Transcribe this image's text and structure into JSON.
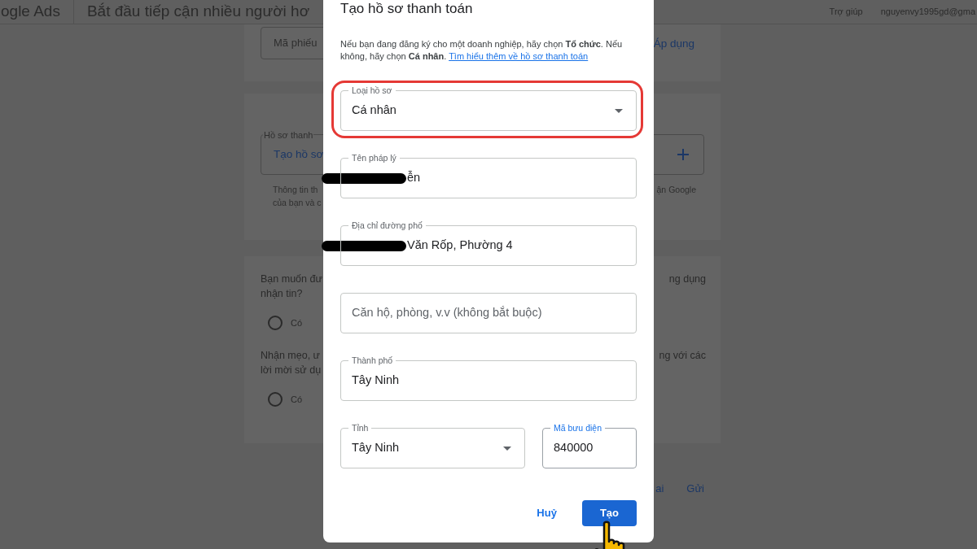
{
  "header": {
    "logo_text": "ogle Ads",
    "title": "Bắt đầu tiếp cận nhiều người hơ",
    "help": "Trợ giúp",
    "account": "nguyenvy1995gd@gma"
  },
  "background": {
    "coupon": {
      "placeholder": "Mã phiếu",
      "apply": "Áp dụng"
    },
    "billing": {
      "label": "Hồ sơ thanh",
      "value": "Tạo hồ sơ",
      "helper_lines": [
        "Thông tin th",
        "của bạn và c"
      ],
      "helper_right": "ận Google"
    },
    "questions": [
      {
        "lines": [
          "Bạn muốn đư",
          "nhận tin?"
        ],
        "right": "ng dụng",
        "option": {
          "label": "Có",
          "selected": false
        }
      },
      {
        "lines": [
          "Nhận mẹo, ư",
          "lời mời sử dụ"
        ],
        "right": "ng với các",
        "option": {
          "label": "Có",
          "selected": false
        }
      }
    ],
    "footer": [
      "ai",
      "Gửi"
    ]
  },
  "dialog": {
    "title": "Tạo hồ sơ thanh toán",
    "description": "Nếu bạn đang đăng ký cho một doanh nghiệp, hãy chọn **Tổ chức**. Nếu không, hãy chọn **Cá nhân**.",
    "link": "Tìm hiểu thêm về hồ sơ thanh toán",
    "rows": [
      [
        {
          "kind": "select",
          "label": "Loại hồ sơ",
          "value": "Cá nhân",
          "highlighted": true
        }
      ],
      [
        {
          "kind": "text",
          "label": "Tên pháp lý",
          "value": "ễn",
          "redacted": true
        }
      ],
      [
        {
          "kind": "text",
          "label": "Địa chỉ đường phố",
          "value": "Văn Rốp, Phường 4",
          "redacted": true
        }
      ],
      [
        {
          "kind": "text",
          "placeholder": "Căn hộ, phòng, v.v (không bắt buộc)"
        }
      ],
      [
        {
          "kind": "text",
          "label": "Thành phố",
          "value": "Tây Ninh"
        }
      ],
      [
        {
          "kind": "select",
          "label": "Tỉnh",
          "value": "Tây Ninh"
        },
        {
          "kind": "text",
          "label": "Mã bưu điện",
          "value": "840000",
          "focused": true
        }
      ]
    ],
    "buttons": [
      {
        "label": "Huỷ",
        "kind": "text"
      },
      {
        "label": "Tạo",
        "kind": "primary"
      }
    ]
  },
  "cursor": {
    "kind": "hand"
  }
}
